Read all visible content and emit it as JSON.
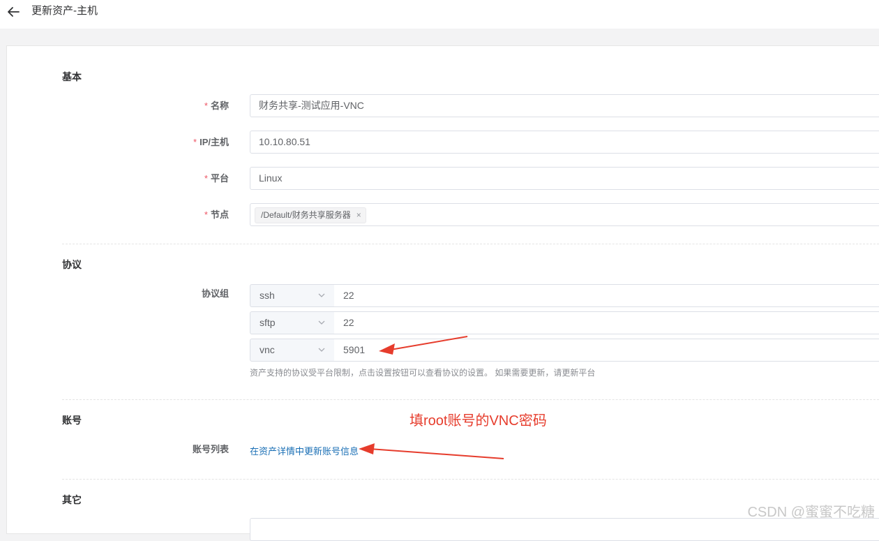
{
  "header": {
    "title": "更新资产-主机"
  },
  "sections": {
    "basic": "基本",
    "protocol": "协议",
    "account": "账号",
    "other": "其它"
  },
  "fields": {
    "name": {
      "label": "名称",
      "value": "财务共享-测试应用-VNC",
      "required": "*"
    },
    "ip": {
      "label": "IP/主机",
      "value": "10.10.80.51",
      "required": "*"
    },
    "platform": {
      "label": "平台",
      "value": "Linux",
      "required": "*"
    },
    "node": {
      "label": "节点",
      "tag": "/Default/财务共享服务器",
      "required": "*"
    }
  },
  "protocols": {
    "label": "协议组",
    "rows": [
      {
        "name": "ssh",
        "port": "22"
      },
      {
        "name": "sftp",
        "port": "22"
      },
      {
        "name": "vnc",
        "port": "5901"
      }
    ],
    "help": "资产支持的协议受平台限制，点击设置按钮可以查看协议的设置。 如果需要更新，请更新平台"
  },
  "accounts": {
    "label": "账号列表",
    "link": "在资产详情中更新账号信息"
  },
  "annotation": "填root账号的VNC密码",
  "watermark": "CSDN @蜜蜜不吃糖",
  "colors": {
    "accent_link": "#1a6fb5",
    "required": "#ed5565",
    "annotation": "#e63c2c"
  },
  "icons": [
    "back-arrow-icon",
    "chevron-down-icon",
    "close-icon"
  ]
}
